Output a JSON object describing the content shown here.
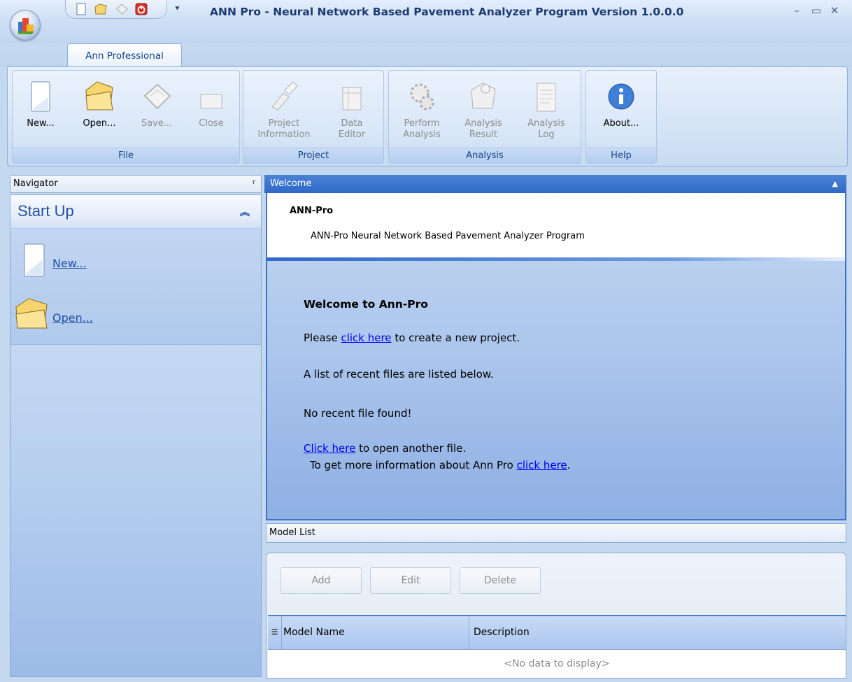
{
  "window": {
    "title": "ANN Pro - Neural Network Based Pavement Analyzer Program Version 1.0.0.0",
    "minimize": "–",
    "maximize": "▭",
    "close": "✕"
  },
  "qat": {
    "dropdown": "⯆"
  },
  "tabs": [
    {
      "label": "Ann Professional"
    }
  ],
  "ribbon": {
    "groups": [
      {
        "label": "File",
        "buttons": [
          {
            "label": "New...",
            "icon": "new-document-icon"
          },
          {
            "label": "Open...",
            "icon": "open-folder-icon"
          },
          {
            "label": "Save...",
            "icon": "save-disk-icon"
          },
          {
            "label": "Close",
            "icon": "close-document-icon"
          }
        ]
      },
      {
        "label": "Project",
        "buttons": [
          {
            "label": "Project\nInformation",
            "icon": "project-info-icon"
          },
          {
            "label": "Data\nEditor",
            "icon": "data-editor-icon"
          }
        ]
      },
      {
        "label": "Analysis",
        "buttons": [
          {
            "label": "Perform\nAnalysis",
            "icon": "gears-icon"
          },
          {
            "label": "Analysis\nResult",
            "icon": "result-folder-icon"
          },
          {
            "label": "Analysis\nLog",
            "icon": "log-document-icon"
          }
        ]
      },
      {
        "label": "Help",
        "buttons": [
          {
            "label": "About...",
            "icon": "info-icon"
          }
        ]
      }
    ]
  },
  "navigator": {
    "title": "Navigator",
    "pin": "📌",
    "section_title": "Start Up",
    "collapse": "⌃",
    "items": [
      {
        "label": "New...",
        "icon": "new-document-icon"
      },
      {
        "label": "Open...",
        "icon": "open-folder-icon"
      }
    ]
  },
  "welcome": {
    "bar_title": "Welcome",
    "collapse": "▲",
    "app_name": "ANN-Pro",
    "app_subtitle": "ANN-Pro Neural Network Based Pavement Analyzer Program",
    "heading": "Welcome to Ann-Pro",
    "line1_pre": "Please ",
    "line1_link": "click here",
    "line1_post": " to create a new project.",
    "line2": "A list of recent files are listed below.",
    "line3": "No recent file found!",
    "line4_link": "Click here",
    "line4_post": " to open another file.",
    "line5_pre": "To get more information about Ann Pro ",
    "line5_link": "click here",
    "line5_post": "."
  },
  "model_list": {
    "title": "Model List",
    "buttons": {
      "add": "Add",
      "edit": "Edit",
      "delete": "Delete"
    },
    "columns": [
      "Model Name",
      "Description"
    ],
    "empty_text": "<No data to display>"
  }
}
